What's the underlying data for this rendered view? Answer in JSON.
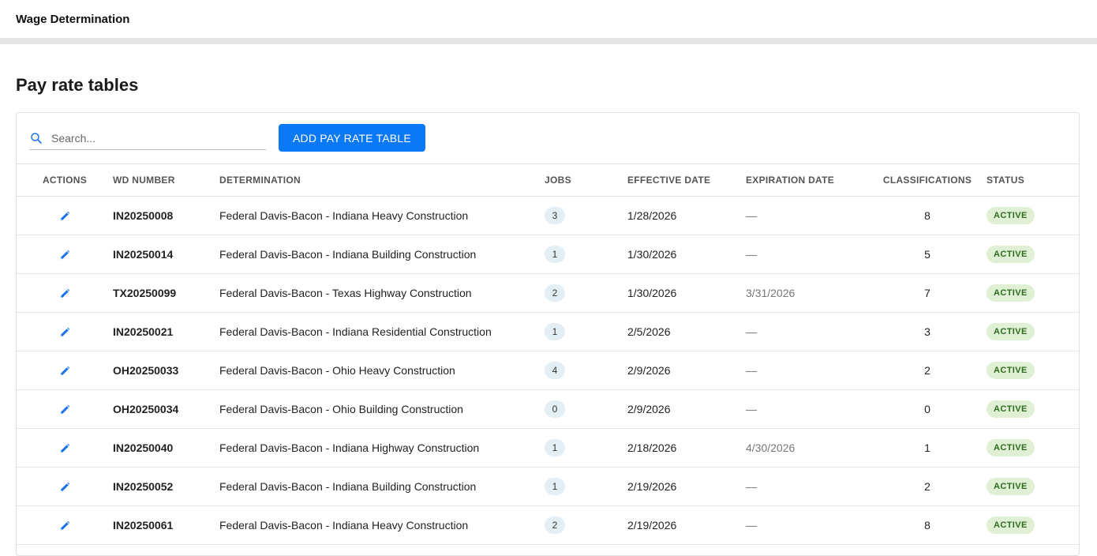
{
  "app": {
    "title": "Wage Determination"
  },
  "page": {
    "title": "Pay rate tables"
  },
  "search": {
    "placeholder": "Search...",
    "value": ""
  },
  "toolbar": {
    "add_label": "ADD PAY RATE TABLE"
  },
  "colors": {
    "accent": "#0b78f5",
    "status_bg": "#dff0d4",
    "status_text": "#2e6b1f",
    "jobs_badge_bg": "#e4eef5"
  },
  "table": {
    "headers": [
      "ACTIONS",
      "WD NUMBER",
      "DETERMINATION",
      "JOBS",
      "EFFECTIVE DATE",
      "EXPIRATION DATE",
      "CLASSIFICATIONS",
      "STATUS"
    ],
    "rows": [
      {
        "wd": "IN20250008",
        "determination": "Federal Davis-Bacon - Indiana Heavy Construction",
        "jobs": "3",
        "effective": "1/28/2026",
        "expiration": "—",
        "classifications": "8",
        "status": "ACTIVE"
      },
      {
        "wd": "IN20250014",
        "determination": "Federal Davis-Bacon - Indiana Building Construction",
        "jobs": "1",
        "effective": "1/30/2026",
        "expiration": "—",
        "classifications": "5",
        "status": "ACTIVE"
      },
      {
        "wd": "TX20250099",
        "determination": "Federal Davis-Bacon - Texas Highway Construction",
        "jobs": "2",
        "effective": "1/30/2026",
        "expiration": "3/31/2026",
        "classifications": "7",
        "status": "ACTIVE"
      },
      {
        "wd": "IN20250021",
        "determination": "Federal Davis-Bacon - Indiana Residential Construction",
        "jobs": "1",
        "effective": "2/5/2026",
        "expiration": "—",
        "classifications": "3",
        "status": "ACTIVE"
      },
      {
        "wd": "OH20250033",
        "determination": "Federal Davis-Bacon - Ohio Heavy Construction",
        "jobs": "4",
        "effective": "2/9/2026",
        "expiration": "—",
        "classifications": "2",
        "status": "ACTIVE"
      },
      {
        "wd": "OH20250034",
        "determination": "Federal Davis-Bacon - Ohio Building Construction",
        "jobs": "0",
        "effective": "2/9/2026",
        "expiration": "—",
        "classifications": "0",
        "status": "ACTIVE"
      },
      {
        "wd": "IN20250040",
        "determination": "Federal Davis-Bacon - Indiana Highway Construction",
        "jobs": "1",
        "effective": "2/18/2026",
        "expiration": "4/30/2026",
        "classifications": "1",
        "status": "ACTIVE"
      },
      {
        "wd": "IN20250052",
        "determination": "Federal Davis-Bacon - Indiana Building Construction",
        "jobs": "1",
        "effective": "2/19/2026",
        "expiration": "—",
        "classifications": "2",
        "status": "ACTIVE"
      },
      {
        "wd": "IN20250061",
        "determination": "Federal Davis-Bacon - Indiana Heavy Construction",
        "jobs": "2",
        "effective": "2/19/2026",
        "expiration": "—",
        "classifications": "8",
        "status": "ACTIVE"
      }
    ]
  }
}
